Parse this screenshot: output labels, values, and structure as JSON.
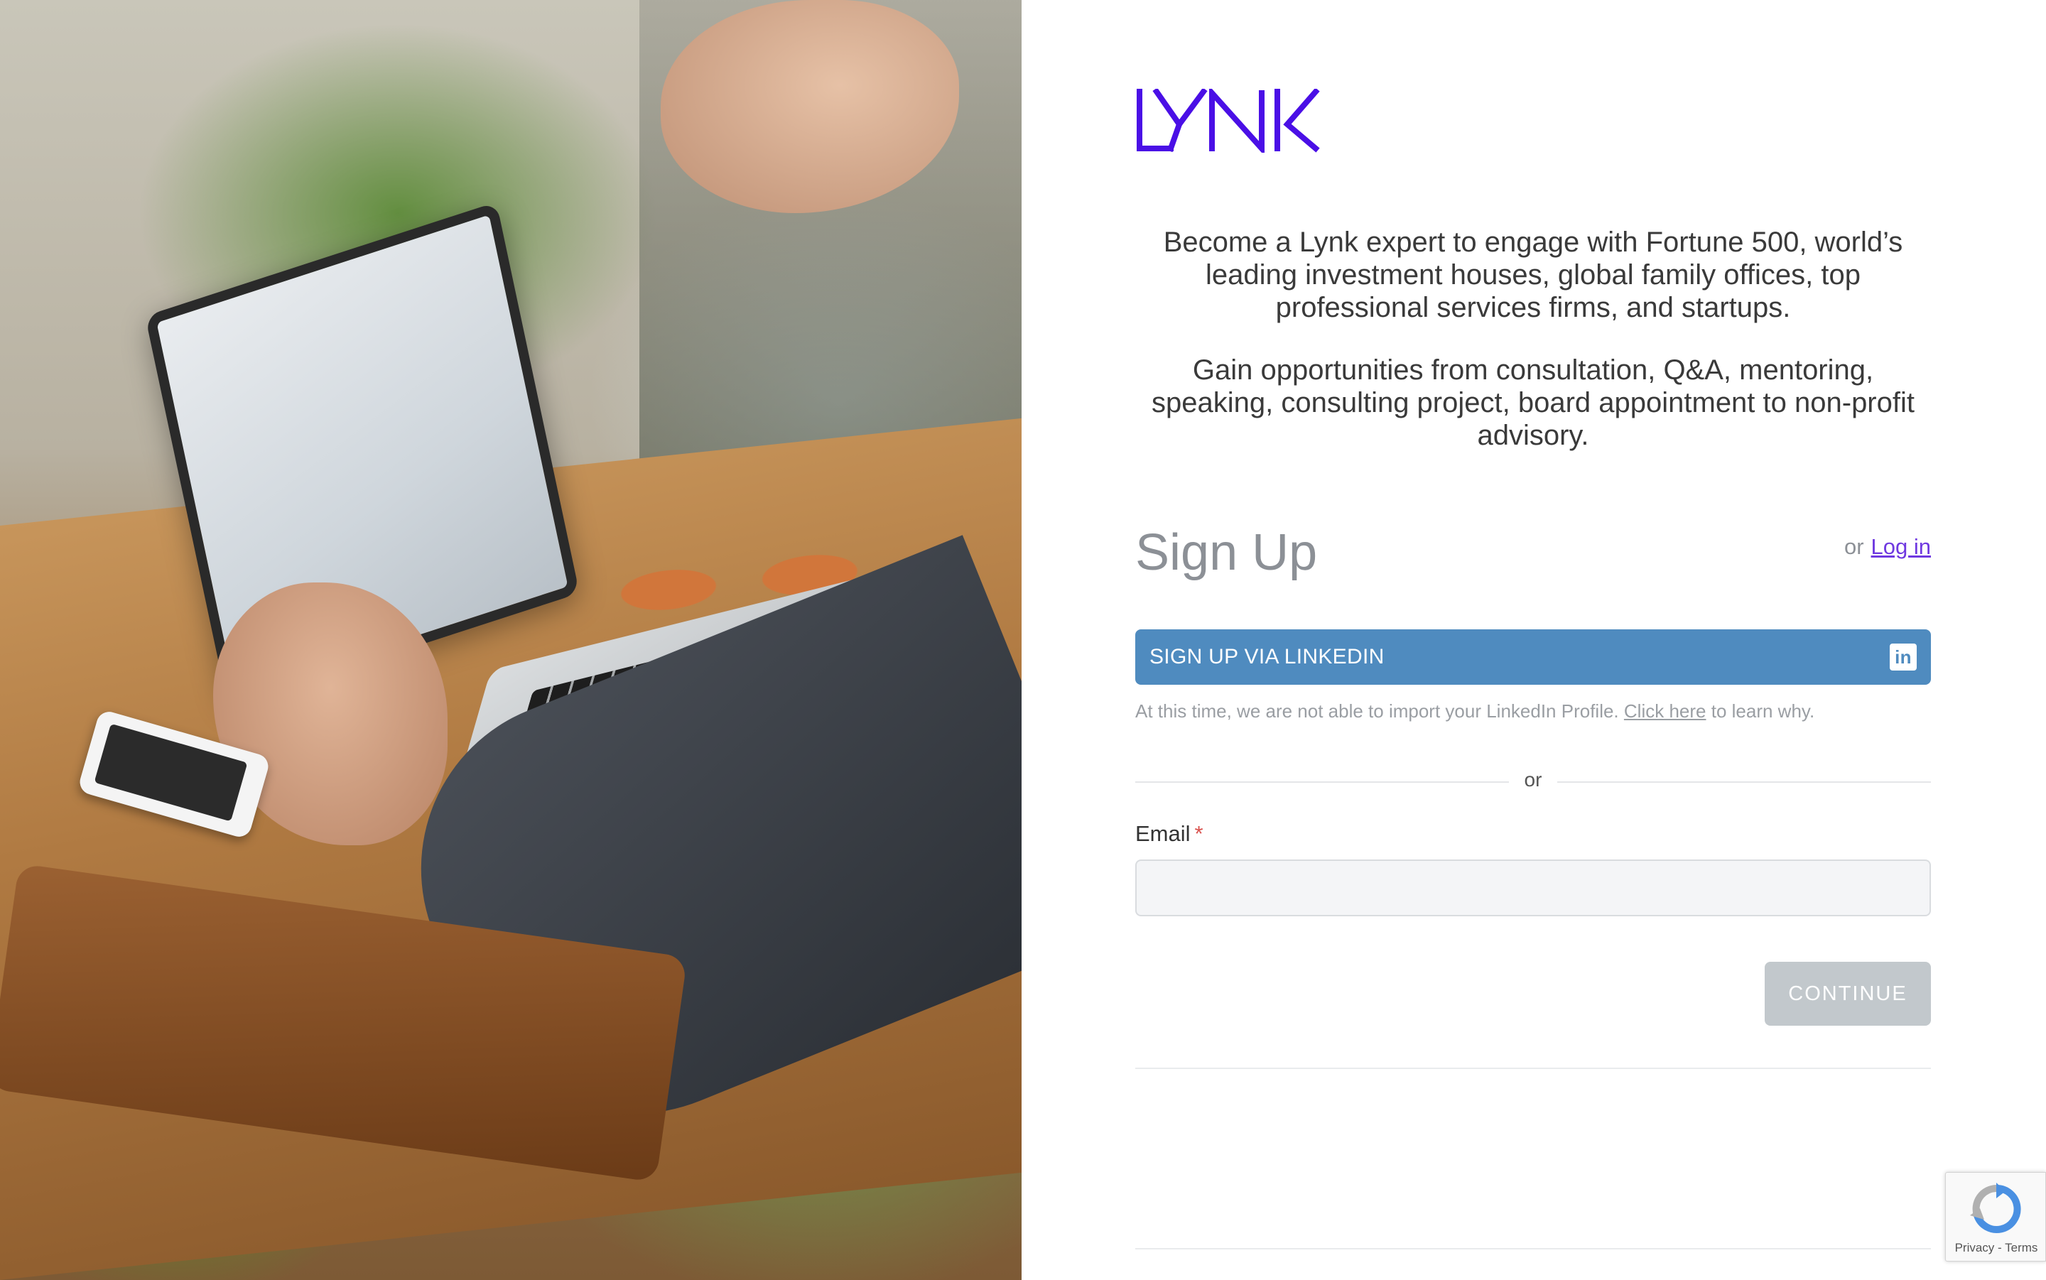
{
  "brand": {
    "name": "LYNK",
    "color": "#4a0fe6"
  },
  "intro": {
    "paragraph1": "Become a Lynk expert to engage with Fortune 500, world’s leading investment houses, global family offices, top professional services firms, and startups.",
    "paragraph2": "Gain opportunities from consultation, Q&A, mentoring, speaking, consulting project, board appointment to non-profit advisory."
  },
  "form": {
    "title": "Sign Up",
    "login_prefix": "or",
    "login_link": "Log in",
    "linkedin_button": "SIGN UP VIA LINKEDIN",
    "linkedin_icon": "linkedin-icon",
    "note_prefix": "At this time, we are not able to import your LinkedIn Profile.",
    "note_link": "Click here",
    "note_suffix": "to learn why.",
    "divider_text": "or",
    "email_label": "Email",
    "email_required_mark": "*",
    "email_value": "",
    "email_placeholder": "",
    "continue_button": "CONTINUE"
  },
  "recaptcha": {
    "privacy": "Privacy",
    "separator": "-",
    "terms": "Terms"
  },
  "colors": {
    "linkedin_blue": "#4f8bbf",
    "link_purple": "#6f39e0",
    "disabled_button": "#c2c8cc",
    "required_red": "#d9534f"
  }
}
